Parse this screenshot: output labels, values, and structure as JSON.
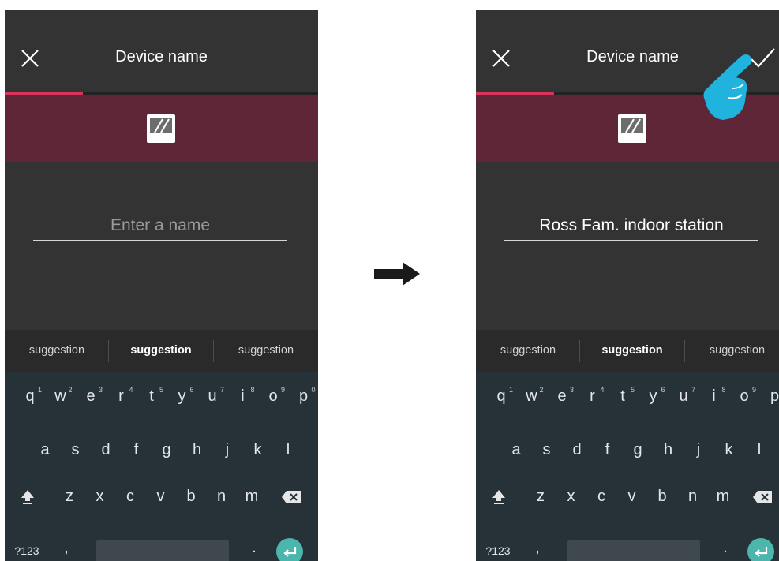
{
  "header": {
    "title": "Device name"
  },
  "field": {
    "placeholder": "Enter a name",
    "entered_value": "Ross Fam. indoor station"
  },
  "progress": {
    "fraction": 0.25
  },
  "colors": {
    "accent": "#d8335a",
    "banner": "#5e2637",
    "panel": "#333333",
    "keyboard": "#263238",
    "enter": "#4db6ac",
    "pointer_hand": "#1fb3de"
  },
  "suggestions": [
    "suggestion",
    "suggestion",
    "suggestion"
  ],
  "keyboard": {
    "row1": [
      {
        "k": "q",
        "s": "1"
      },
      {
        "k": "w",
        "s": "2"
      },
      {
        "k": "e",
        "s": "3"
      },
      {
        "k": "r",
        "s": "4"
      },
      {
        "k": "t",
        "s": "5"
      },
      {
        "k": "y",
        "s": "6"
      },
      {
        "k": "u",
        "s": "7"
      },
      {
        "k": "i",
        "s": "8"
      },
      {
        "k": "o",
        "s": "9"
      },
      {
        "k": "p",
        "s": "0"
      }
    ],
    "row2": [
      "a",
      "s",
      "d",
      "f",
      "g",
      "h",
      "j",
      "k",
      "l"
    ],
    "row3": [
      "z",
      "x",
      "c",
      "v",
      "b",
      "n",
      "m"
    ],
    "numbers_key": "?123",
    "comma_key": ",",
    "period_key": "."
  },
  "icons": {
    "close": "close-icon",
    "confirm": "checkmark-icon",
    "device": "device-frame-icon",
    "shift": "shift-icon",
    "backspace": "backspace-icon",
    "enter": "enter-arrow-icon",
    "transition": "right-arrow-icon",
    "pointer": "pointing-hand-icon"
  }
}
